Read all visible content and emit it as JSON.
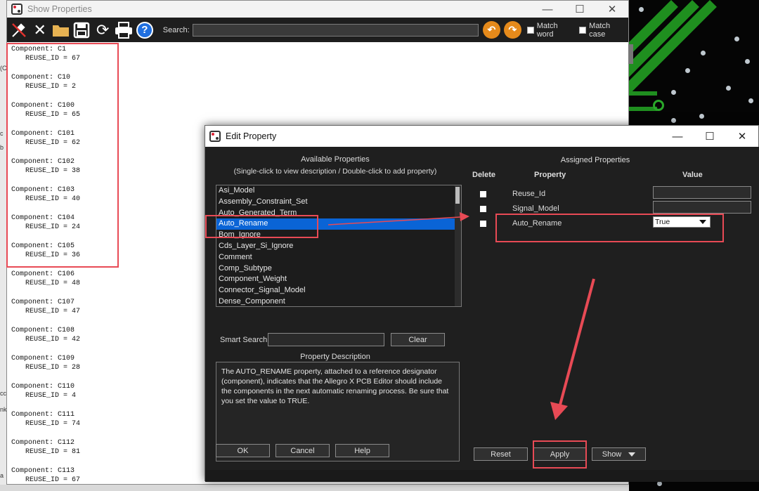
{
  "show_properties": {
    "title": "Show Properties",
    "search_label": "Search:",
    "search_value": "",
    "match_word_label": "Match word",
    "match_case_label": "Match case",
    "components": [
      {
        "component": "Component: C1",
        "reuse": "REUSE_ID = 67"
      },
      {
        "component": "Component: C10",
        "reuse": "REUSE_ID = 2"
      },
      {
        "component": "Component: C100",
        "reuse": "REUSE_ID = 65"
      },
      {
        "component": "Component: C101",
        "reuse": "REUSE_ID = 62"
      },
      {
        "component": "Component: C102",
        "reuse": "REUSE_ID = 38"
      },
      {
        "component": "Component: C103",
        "reuse": "REUSE_ID = 40"
      },
      {
        "component": "Component: C104",
        "reuse": "REUSE_ID = 24"
      },
      {
        "component": "Component: C105",
        "reuse": "REUSE_ID = 36"
      },
      {
        "component": "Component: C106",
        "reuse": "REUSE_ID = 48"
      },
      {
        "component": "Component: C107",
        "reuse": "REUSE_ID = 47"
      },
      {
        "component": "Component: C108",
        "reuse": "REUSE_ID = 42"
      },
      {
        "component": "Component: C109",
        "reuse": "REUSE_ID = 28"
      },
      {
        "component": "Component: C110",
        "reuse": "REUSE_ID = 4"
      },
      {
        "component": "Component: C111",
        "reuse": "REUSE_ID = 74"
      },
      {
        "component": "Component: C112",
        "reuse": "REUSE_ID = 81"
      },
      {
        "component": "Component: C113",
        "reuse": "REUSE_ID = 67"
      }
    ]
  },
  "edit_property": {
    "title": "Edit Property",
    "available_header": "Available Properties",
    "available_hint": "(Single-click to view description / Double-click to add property)",
    "available_items": [
      "Asi_Model",
      "Assembly_Constraint_Set",
      "Auto_Generated_Term",
      "Auto_Rename",
      "Bom_Ignore",
      "Cds_Layer_Si_Ignore",
      "Comment",
      "Comp_Subtype",
      "Component_Weight",
      "Connector_Signal_Model",
      "Dense_Component"
    ],
    "selected_item": "Auto_Rename",
    "smart_search_label": "Smart Search",
    "clear_label": "Clear",
    "description_header": "Property Description",
    "description_text": "The AUTO_RENAME property, attached to a reference designator (component), indicates that the Allegro X PCB Editor should include the components in the next automatic renaming process. Be sure that you set the value to TRUE.",
    "ok_label": "OK",
    "cancel_label": "Cancel",
    "help_label": "Help",
    "assigned_header": "Assigned Properties",
    "col_delete": "Delete",
    "col_property": "Property",
    "col_value": "Value",
    "assigned": [
      {
        "name": "Reuse_Id",
        "value": ""
      },
      {
        "name": "Signal_Model",
        "value": ""
      },
      {
        "name": "Auto_Rename",
        "value": "True"
      }
    ],
    "reset_label": "Reset",
    "apply_label": "Apply",
    "show_label": "Show"
  },
  "colors": {
    "highlight_red": "#e84a55",
    "selection_blue": "#0a64d6",
    "nav_orange": "#e58a1b"
  }
}
